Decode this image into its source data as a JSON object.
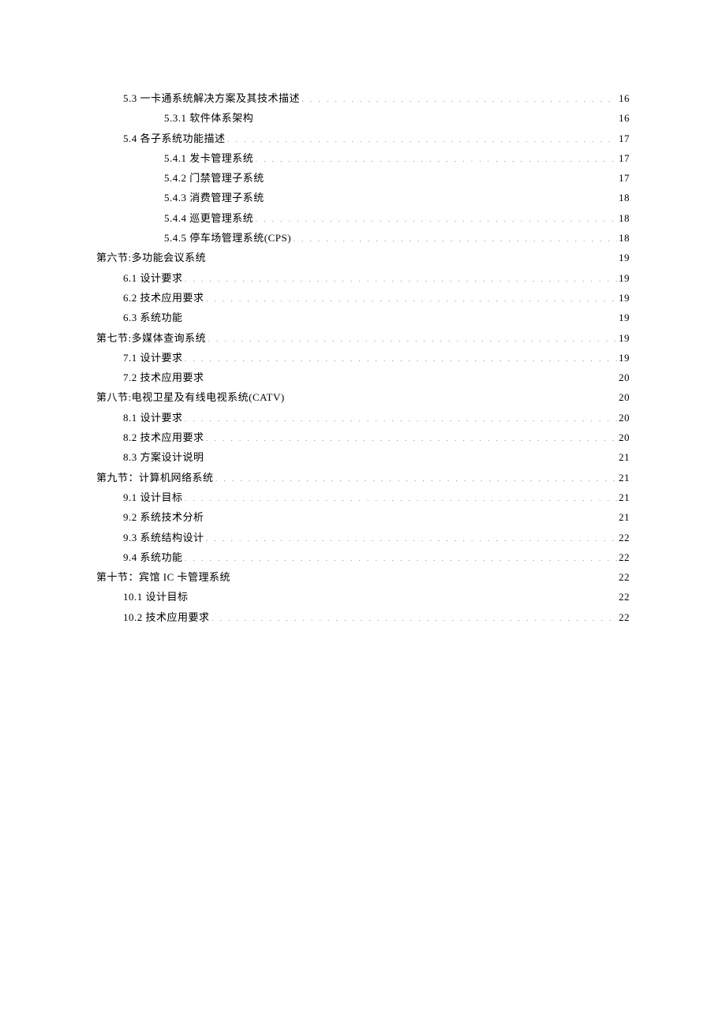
{
  "toc": [
    {
      "indent": 1,
      "title": "5.3 一卡通系统解决方案及其技术描述",
      "page": "16"
    },
    {
      "indent": 2,
      "title": "5.3.1 软件体系架构",
      "page": "16"
    },
    {
      "indent": 1,
      "title": "5.4 各子系统功能描述",
      "page": "17"
    },
    {
      "indent": 2,
      "title": "5.4.1 发卡管理系统",
      "page": "17"
    },
    {
      "indent": 2,
      "title": "5.4.2 门禁管理子系统",
      "page": "17"
    },
    {
      "indent": 2,
      "title": "5.4.3 消费管理子系统",
      "page": "18"
    },
    {
      "indent": 2,
      "title": "5.4.4 巡更管理系统",
      "page": "18"
    },
    {
      "indent": 2,
      "title": "5.4.5 停车场管理系统(CPS)",
      "page": "18"
    },
    {
      "indent": 0,
      "title": "第六节:多功能会议系统",
      "page": "19"
    },
    {
      "indent": 1,
      "title": "6.1 设计要求",
      "page": "19"
    },
    {
      "indent": 1,
      "title": "6.2 技术应用要求",
      "page": "19"
    },
    {
      "indent": 1,
      "title": "6.3 系统功能",
      "page": "19"
    },
    {
      "indent": 0,
      "title": "第七节:多媒体查询系统",
      "page": "19"
    },
    {
      "indent": 1,
      "title": "7.1 设计要求",
      "page": "19"
    },
    {
      "indent": 1,
      "title": "7.2 技术应用要求",
      "page": "20"
    },
    {
      "indent": 0,
      "title": "第八节:电视卫星及有线电视系统(CATV)",
      "page": "20"
    },
    {
      "indent": 1,
      "title": "8.1 设计要求",
      "page": "20"
    },
    {
      "indent": 1,
      "title": "8.2 技术应用要求",
      "page": "20"
    },
    {
      "indent": 1,
      "title": "8.3 方案设计说明",
      "page": "21"
    },
    {
      "indent": 0,
      "title": "第九节：计算机网络系统",
      "page": "21"
    },
    {
      "indent": 1,
      "title": "9.1 设计目标",
      "page": "21"
    },
    {
      "indent": 1,
      "title": "9.2 系统技术分析",
      "page": "21"
    },
    {
      "indent": 1,
      "title": "9.3 系统结构设计",
      "page": "22"
    },
    {
      "indent": 1,
      "title": "9.4 系统功能",
      "page": "22"
    },
    {
      "indent": 0,
      "title": "第十节：宾馆 IC 卡管理系统",
      "page": "22"
    },
    {
      "indent": 1,
      "title": "10.1 设计目标",
      "page": "22"
    },
    {
      "indent": 1,
      "title": "10.2 技术应用要求",
      "page": "22"
    }
  ]
}
